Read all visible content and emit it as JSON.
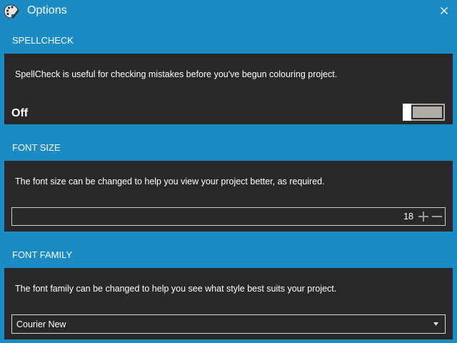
{
  "window": {
    "title": "Options",
    "app_icon": "palette-brush-icon",
    "close_icon": "close-icon"
  },
  "spellcheck": {
    "header": "SPELLCHECK",
    "description": "SpellCheck is useful for checking mistakes before you've begun colouring project.",
    "toggle_label": "Off",
    "enabled": false
  },
  "font_size": {
    "header": "FONT SIZE",
    "description": "The font size can be changed to help you view your project better, as required.",
    "value": "18",
    "increment_icon": "plus-icon",
    "decrement_icon": "minus-icon"
  },
  "font_family": {
    "header": "FONT FAMILY",
    "description": "The font family can be changed to help you see what style best suits your project.",
    "selected": "Courier New",
    "dropdown_icon": "caret-down-icon"
  },
  "colors": {
    "accent": "#1b8bc5",
    "panel_background": "#282828",
    "toggle_track": "#b0aba3"
  }
}
